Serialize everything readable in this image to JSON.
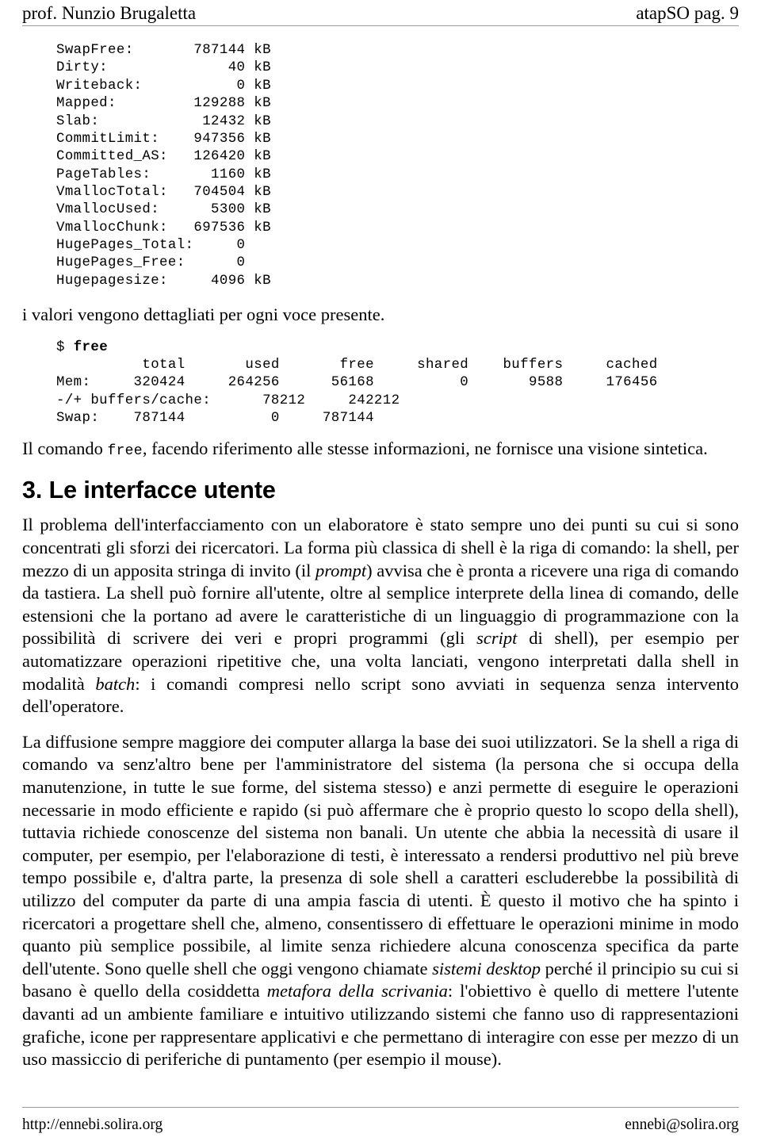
{
  "header": {
    "left": "prof. Nunzio Brugaletta",
    "right": "atapSO pag. 9"
  },
  "footer": {
    "left": "http://ennebi.solira.org",
    "right": "ennebi@solira.org"
  },
  "meminfo_listing": "SwapFree:       787144 kB\nDirty:              40 kB\nWriteback:           0 kB\nMapped:         129288 kB\nSlab:            12432 kB\nCommitLimit:    947356 kB\nCommitted_AS:   126420 kB\nPageTables:       1160 kB\nVmallocTotal:   704504 kB\nVmallocUsed:      5300 kB\nVmallocChunk:   697536 kB\nHugePages_Total:     0\nHugePages_Free:      0\nHugepagesize:     4096 kB",
  "caption_after_meminfo": "i valori vengono dettagliati per ogni voce presente.",
  "free_command": {
    "prompt": "$ ",
    "command": "free"
  },
  "free_listing": "          total       used       free     shared    buffers     cached\nMem:     320424     264256      56168          0       9588     176456\n-/+ buffers/cache:      78212     242212\nSwap:    787144          0     787144",
  "free_note": {
    "before": "Il comando ",
    "code": "free",
    "after": ", facendo riferimento alle stesse informazioni, ne fornisce una visione sintetica."
  },
  "section": {
    "heading": "3. Le interfacce utente"
  },
  "paragraphs": {
    "p1_a": "Il problema dell'interfacciamento con un elaboratore è stato sempre uno dei punti su cui si sono concentrati gli sforzi dei ricercatori. La forma più classica di shell è la riga di comando: la shell, per mezzo di un apposita stringa di invito (il ",
    "p1_em1": "prompt",
    "p1_b": ") avvisa che è pronta a ricevere una riga di comando da tastiera. La shell può fornire all'utente, oltre al semplice interprete della linea di comando, delle estensioni che la portano ad avere le caratteristiche di un linguaggio di programmazione con la possibilità di scrivere dei veri e propri programmi (gli ",
    "p1_em2": "script",
    "p1_c": " di shell), per esempio per automatizzare operazioni ripetitive che, una volta lanciati, vengono interpretati dalla shell in modalità ",
    "p1_em3": "batch",
    "p1_d": ": i comandi compresi nello script sono avviati in sequenza senza intervento dell'operatore.",
    "p2_a": "La diffusione sempre maggiore dei computer allarga la base dei suoi utilizzatori. Se la shell a riga di comando va senz'altro bene per l'amministratore del sistema (la persona che si occupa della manutenzione, in tutte le sue forme, del sistema stesso) e anzi permette di eseguire le operazioni necessarie in modo efficiente e rapido (si può affermare che è proprio questo lo scopo della shell), tuttavia richiede conoscenze del sistema non banali. Un utente che abbia la necessità di usare il computer, per esempio, per  l'elaborazione di testi, è interessato a rendersi produttivo nel più breve tempo possibile e, d'altra parte, la presenza di sole shell a caratteri escluderebbe la possibilità di utilizzo del computer da parte di una ampia fascia di utenti. È questo il motivo che ha spinto i ricercatori a progettare shell che, almeno, consentissero di effettuare le operazioni minime in modo quanto più semplice possibile, al limite senza richiedere alcuna conoscenza specifica da parte dell'utente. Sono quelle shell che oggi vengono chiamate ",
    "p2_em1": "sistemi desktop",
    "p2_b": " perché il principio su cui si basano è quello della cosiddetta ",
    "p2_em2": "metafora della scrivania",
    "p2_c": ": l'obiettivo è quello di mettere l'utente davanti ad un ambiente familiare e intuitivo utilizzando sistemi che fanno uso di rappresentazioni grafiche, icone per rappresentare applicativi e che permettano di interagire con esse per mezzo di un uso massiccio di periferiche di puntamento (per esempio il mouse)."
  }
}
